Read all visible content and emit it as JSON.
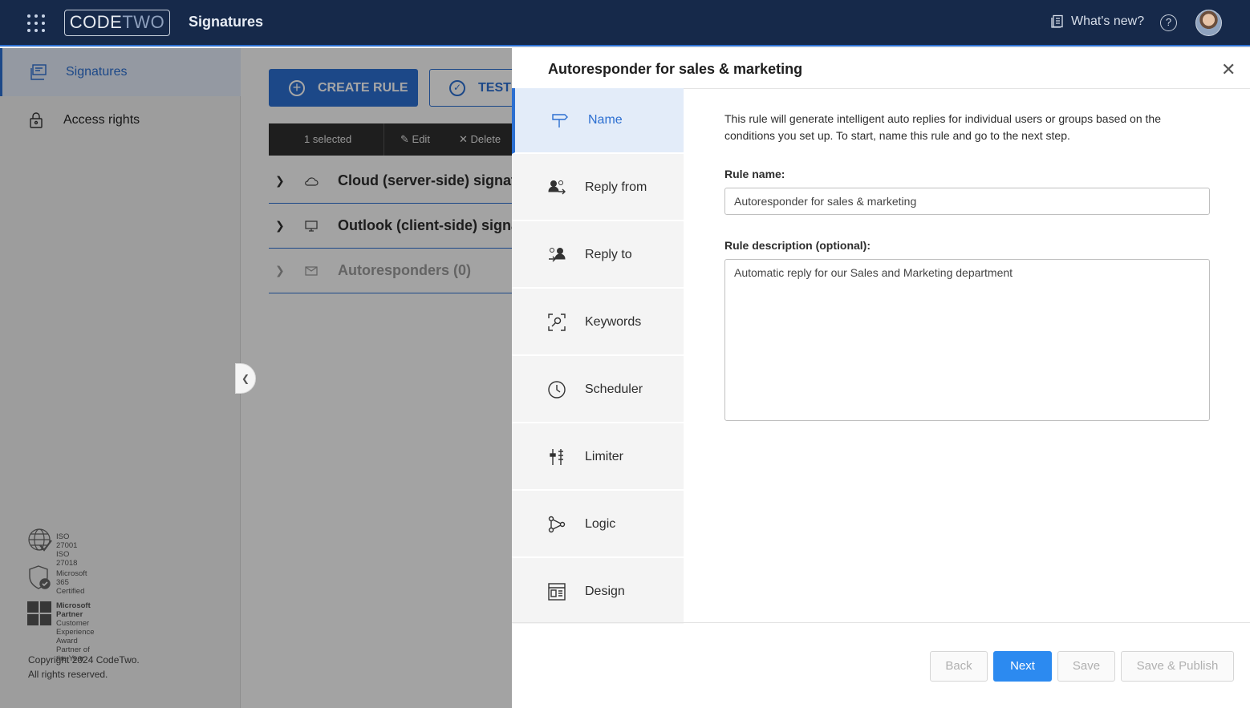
{
  "topbar": {
    "logo_code": "CODE",
    "logo_two": "TWO",
    "app_title": "Signatures",
    "whats_new": "What's new?",
    "help": "?"
  },
  "sidebar": {
    "items": [
      {
        "label": "Signatures",
        "icon": "signatures-icon",
        "active": true
      },
      {
        "label": "Access rights",
        "icon": "lock-icon",
        "active": false
      }
    ],
    "badges": [
      {
        "line1": "ISO 27001",
        "line2": "ISO 27018",
        "line3": ""
      },
      {
        "line1": "Microsoft 365",
        "line2": "Certified",
        "line3": ""
      },
      {
        "line1": "Microsoft Partner",
        "line2": "Customer Experience Award",
        "line3": "Partner of the Year"
      }
    ],
    "copyright_line1": "Copyright 2024 CodeTwo.",
    "copyright_line2": "All rights reserved."
  },
  "main": {
    "create_rule": "CREATE RULE",
    "test": "TEST",
    "selection": {
      "count": "1 selected",
      "edit": "Edit",
      "delete": "Delete"
    },
    "tree": [
      {
        "label": "Cloud (server-side) signatures",
        "icon": "cloud-icon"
      },
      {
        "label": "Outlook (client-side) signatures",
        "icon": "monitor-icon"
      },
      {
        "label": "Autoresponders (0)",
        "icon": "autoresponder-icon"
      }
    ]
  },
  "panel": {
    "title": "Autoresponder for sales & marketing",
    "steps": [
      {
        "label": "Name",
        "icon": "signpost-icon",
        "active": true
      },
      {
        "label": "Reply from",
        "icon": "reply-from-icon",
        "active": false
      },
      {
        "label": "Reply to",
        "icon": "reply-to-icon",
        "active": false
      },
      {
        "label": "Keywords",
        "icon": "keywords-icon",
        "active": false
      },
      {
        "label": "Scheduler",
        "icon": "clock-icon",
        "active": false
      },
      {
        "label": "Limiter",
        "icon": "limiter-icon",
        "active": false
      },
      {
        "label": "Logic",
        "icon": "logic-icon",
        "active": false
      },
      {
        "label": "Design",
        "icon": "design-icon",
        "active": false
      }
    ],
    "intro": "This rule will generate intelligent auto replies for individual users or groups based on the conditions you set up. To start, name this rule and go to the next step.",
    "rule_name_label": "Rule name:",
    "rule_name_value": "Autoresponder for sales & marketing",
    "rule_desc_label": "Rule description (optional):",
    "rule_desc_value": "Automatic reply for our Sales and Marketing department",
    "buttons": {
      "back": "Back",
      "next": "Next",
      "save": "Save",
      "save_publish": "Save & Publish"
    }
  },
  "colors": {
    "accent": "#2c6fd1",
    "topbar": "#16294a",
    "primary_button": "#2c8af0"
  }
}
